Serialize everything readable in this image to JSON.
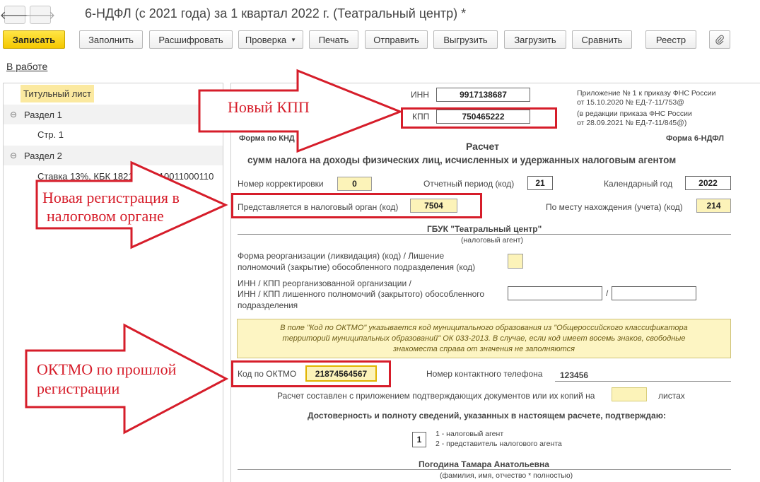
{
  "window": {
    "title": "6-НДФЛ (с 2021 года) за 1 квартал 2022 г. (Театральный центр) *",
    "status_link": "В работе"
  },
  "toolbar": {
    "save": "Записать",
    "fill": "Заполнить",
    "decode": "Расшифровать",
    "check": "Проверка",
    "print": "Печать",
    "send": "Отправить",
    "export": "Выгрузить",
    "import": "Загрузить",
    "compare": "Сравнить",
    "registry": "Реестр"
  },
  "sidebar": {
    "items": [
      {
        "label": "Титульный лист"
      },
      {
        "label": "Раздел 1",
        "toggle": "⊖"
      },
      {
        "label": "Стр. 1"
      },
      {
        "label": "Раздел 2",
        "toggle": "⊖"
      },
      {
        "label": "Ставка 13%, КБК 18210102010011000110"
      }
    ]
  },
  "form": {
    "inn_label": "ИНН",
    "inn": "9917138687",
    "kpp_label": "КПП",
    "kpp": "750465222",
    "appendix": [
      "Приложение № 1 к приказу ФНС России",
      "от 15.10.2020 № ЕД-7-11/753@",
      "(в редакции приказа ФНС России",
      "от 28.09.2021 № ЕД-7-11/845@)"
    ],
    "form_code": "Форма по КНД 1151100",
    "form_name": "Форма 6-НДФЛ",
    "heading": "Расчет",
    "subheading": "сумм налога на доходы физических лиц, исчисленных и удержанных налоговым агентом",
    "correction_label": "Номер корректировки",
    "correction": "0",
    "period_label": "Отчетный период (код)",
    "period": "21",
    "year_label": "Календарный год",
    "year": "2022",
    "tax_office_label": "Представляется в налоговый орган (код)",
    "tax_office": "7504",
    "location_label": "По месту нахождения (учета) (код)",
    "location": "214",
    "agent_name": "ГБУК \"Театральный центр\"",
    "agent_caption": "(налоговый агент)",
    "reorg_label_1": "Форма реорганизации (ликвидация) (код) / Лишение",
    "reorg_label_2": "полномочий (закрытие) обособленного подразделения (код)",
    "reorg_inn_1": "ИНН / КПП реорганизованной организации /",
    "reorg_inn_2": "ИНН / КПП лишенного полномочий (закрытого) обособленного",
    "reorg_inn_3": "подразделения",
    "slash": "/",
    "note_1": "В поле \"Код по ОКТМО\" указывается код муниципального образования из \"Общероссийского классификатора",
    "note_2": "территорий муниципальных образований\" ОК 033-2013. В случае, если код имеет восемь знаков, свободные",
    "note_3": "знакоместа справа от значения не заполняются",
    "oktmo_label": "Код по ОКТМО",
    "oktmo": "21874564567",
    "phone_label": "Номер контактного телефона",
    "phone": "123456",
    "attach_label": "Расчет составлен с приложением подтверждающих документов или их копий на",
    "attach_suffix": "листах",
    "confirm": "Достоверность и полноту сведений, указанных в настоящем расчете, подтверждаю:",
    "signer_code": "1",
    "signer_opt_1": "1 - налоговый агент",
    "signer_opt_2": "2 - представитель налогового агента",
    "person_name": "Погодина Тамара Анатольевна",
    "person_caption": "(фамилия, имя, отчество * полностью)"
  },
  "annotations": {
    "new_kpp": "Новый КПП",
    "new_reg_1": "Новая регистрация в",
    "new_reg_2": "налоговом органе",
    "oktmo_1": "ОКТМО по прошлой",
    "oktmo_2": "регистрации",
    "color": "#d61d2a"
  }
}
